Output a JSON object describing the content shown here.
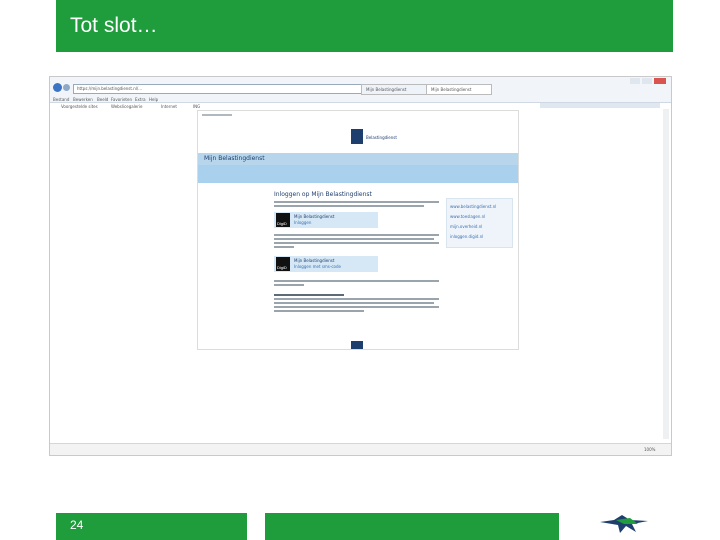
{
  "slide": {
    "title": "Tot slot…",
    "number": "24",
    "green": "#1f9c3c"
  },
  "browser": {
    "address": "https://mijn.belastingdienst.nl/...",
    "tabs": [
      "Mijn Belastingdienst",
      "Mijn Belastingdienst"
    ],
    "menu": [
      "Bestand",
      "Bewerken",
      "Beeld",
      "Favorieten",
      "Extra",
      "Help"
    ],
    "favorites": [
      "Voorgestelde sites",
      "Webslicegalerie",
      "Internet",
      "ING"
    ],
    "status_zoom": "100%"
  },
  "site": {
    "page_title": "Mijn Belastingdienst",
    "logo_text": "Belastingdienst",
    "login_heading": "Inloggen op Mijn Belastingdienst",
    "option1_title": "Mijn Belastingdienst",
    "option1_sub": "Inloggen",
    "option2_title": "Mijn Belastingdienst",
    "option2_sub": "Inloggen met sms-code",
    "digid": "DigiD",
    "side_links": [
      "www.belastingdienst.nl",
      "www.toeslagen.nl",
      "mijn.overheid.nl",
      "inloggen.digid.nl"
    ]
  }
}
